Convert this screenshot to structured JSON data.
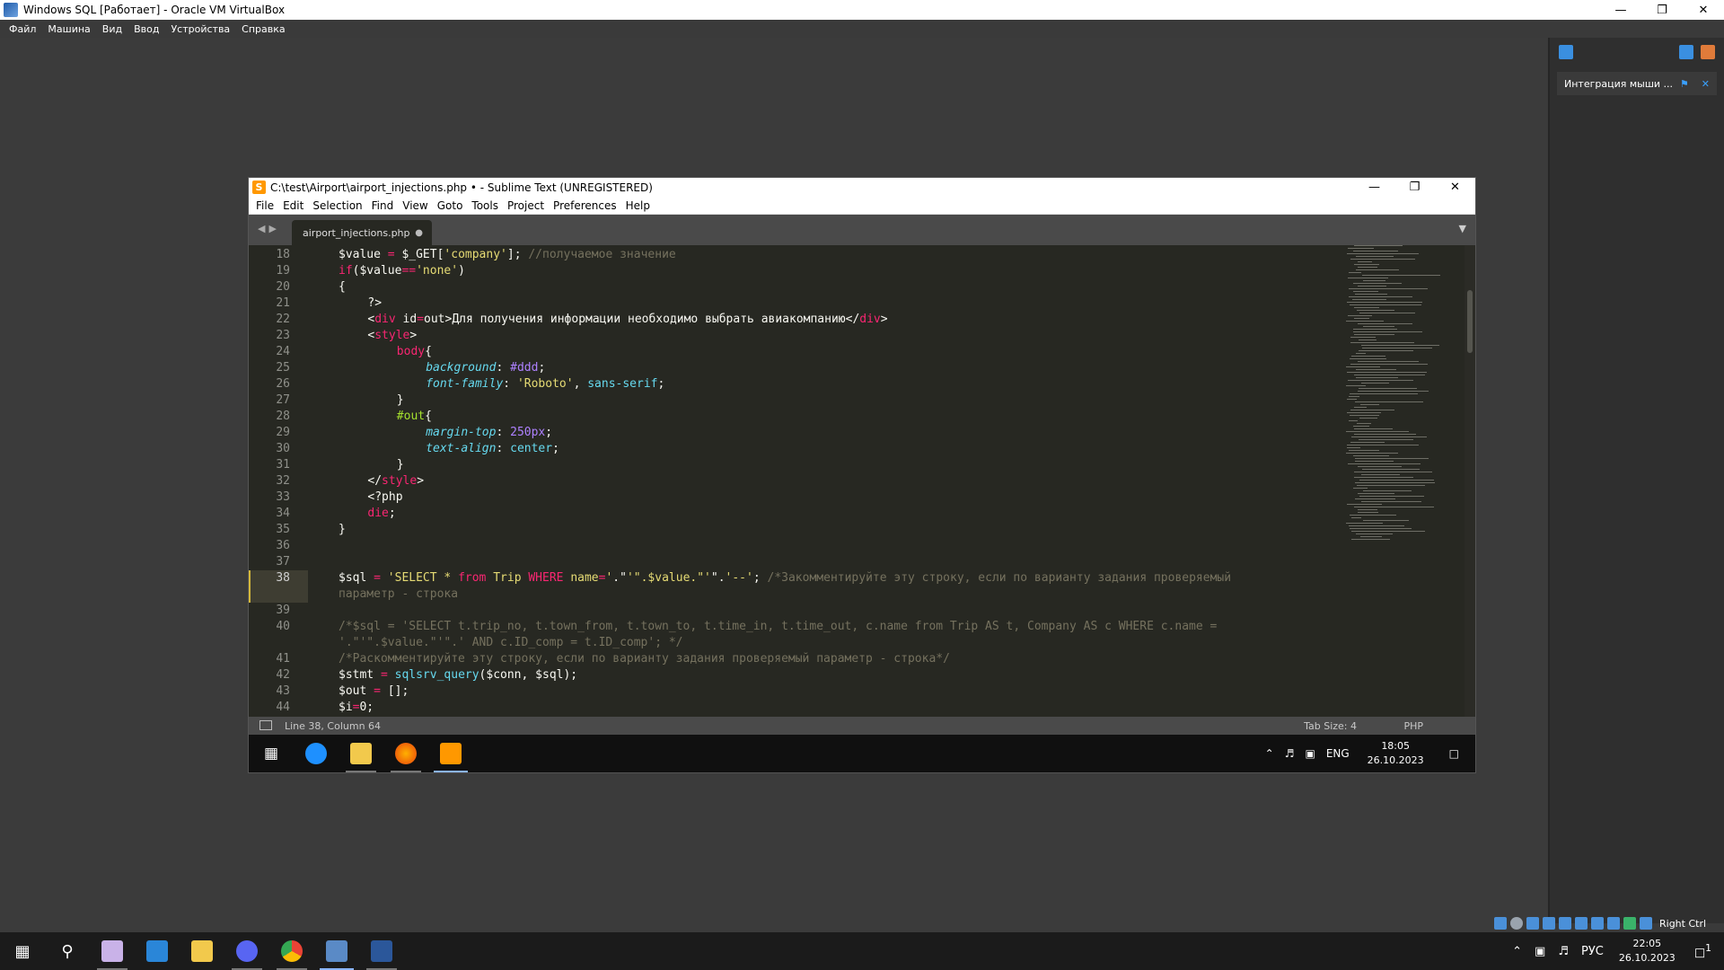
{
  "vbox": {
    "title": "Windows SQL [Работает] - Oracle VM VirtualBox",
    "menu": [
      "Файл",
      "Машина",
      "Вид",
      "Ввод",
      "Устройства",
      "Справка"
    ],
    "notification": "Интеграция мыши ...",
    "host_key": "Right Ctrl"
  },
  "sublime": {
    "title": "C:\\test\\Airport\\airport_injections.php • - Sublime Text (UNREGISTERED)",
    "menu": [
      "File",
      "Edit",
      "Selection",
      "Find",
      "View",
      "Goto",
      "Tools",
      "Project",
      "Preferences",
      "Help"
    ],
    "tab_name": "airport_injections.php",
    "status": {
      "position": "Line 38, Column 64",
      "tab_size": "Tab Size: 4",
      "syntax": "PHP"
    }
  },
  "code_lines": [
    {
      "n": "18",
      "text": "$value = $_GET['company']; //получаемое значение"
    },
    {
      "n": "19",
      "text": "if($value=='none')"
    },
    {
      "n": "20",
      "text": "{"
    },
    {
      "n": "21",
      "text": "?>"
    },
    {
      "n": "22",
      "text": "<div id=out>Для получения информации необходимо выбрать авиакомпанию</div>"
    },
    {
      "n": "23",
      "text": "<style>"
    },
    {
      "n": "24",
      "text": "body{"
    },
    {
      "n": "25",
      "text": "background: #ddd;"
    },
    {
      "n": "26",
      "text": "font-family: 'Roboto', sans-serif;"
    },
    {
      "n": "27",
      "text": "}"
    },
    {
      "n": "28",
      "text": "#out{"
    },
    {
      "n": "29",
      "text": "margin-top: 250px;"
    },
    {
      "n": "30",
      "text": "text-align: center;"
    },
    {
      "n": "31",
      "text": "}"
    },
    {
      "n": "32",
      "text": "</style>"
    },
    {
      "n": "33",
      "text": "<?php"
    },
    {
      "n": "34",
      "text": "die;"
    },
    {
      "n": "35",
      "text": "}"
    },
    {
      "n": "36",
      "text": ""
    },
    {
      "n": "37",
      "text": ""
    },
    {
      "n": "38",
      "text": "$sql = 'SELECT * from Trip WHERE name='.\"'\".$value.\"'\".'--'; /*Закомментируйте эту строку, если по варианту задания проверяемый"
    },
    {
      "n": "",
      "text": "параметр - строка"
    },
    {
      "n": "39",
      "text": ""
    },
    {
      "n": "40",
      "text": "/*$sql = 'SELECT t.trip_no, t.town_from, t.town_to, t.time_in, t.time_out, c.name from Trip AS t, Company AS c WHERE c.name ="
    },
    {
      "n": "",
      "text": "'.\"'\".$value.\"'\".' AND c.ID_comp = t.ID_comp'; */"
    },
    {
      "n": "41",
      "text": "/*Раскомментируйте эту строку, если по варианту задания проверяемый параметр - строка*/"
    },
    {
      "n": "42",
      "text": "$stmt = sqlsrv_query($conn, $sql);"
    },
    {
      "n": "43",
      "text": "$out = [];"
    },
    {
      "n": "44",
      "text": "$i=0;"
    }
  ],
  "guest_tray": {
    "lang": "ENG",
    "time": "18:05",
    "date": "26.10.2023"
  },
  "host_tray": {
    "lang": "РУС",
    "time": "22:05",
    "date": "26.10.2023",
    "notif_count": "1"
  },
  "colors": {
    "bg_editor": "#272822",
    "keyword": "#f92672",
    "string": "#e6db74",
    "comment": "#75715e",
    "function": "#66d9ef",
    "number": "#ae81ff",
    "attr": "#a6e22e"
  }
}
